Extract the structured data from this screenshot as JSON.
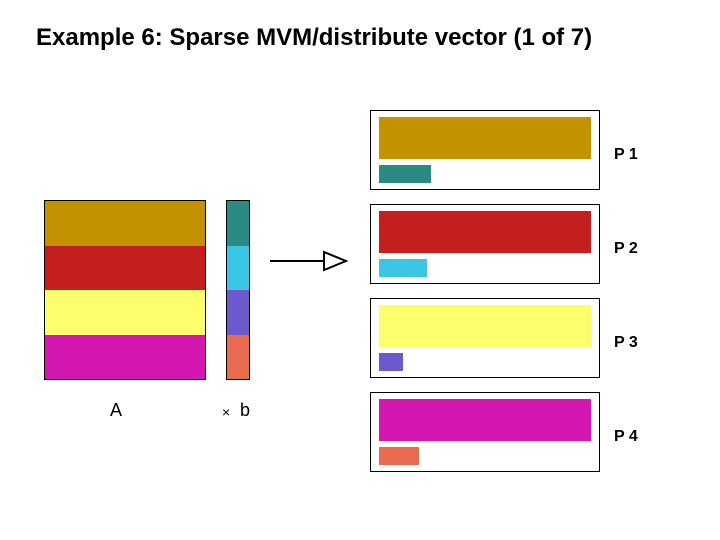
{
  "title": "Example 6: Sparse MVM/distribute vector (1 of 7)",
  "matrix_label": "A",
  "times_symbol": "×",
  "vector_label": "b",
  "matrix_rows": [
    "gold",
    "red",
    "yellow",
    "magenta"
  ],
  "vector_segments": [
    "teal",
    "cyan",
    "violet",
    "coral"
  ],
  "processors": [
    {
      "label": "P 1",
      "primary": "gold",
      "secondary": "teal",
      "secondary_width": 52
    },
    {
      "label": "P 2",
      "primary": "red",
      "secondary": "cyan",
      "secondary_width": 48
    },
    {
      "label": "P 3",
      "primary": "yellow",
      "secondary": "violet",
      "secondary_width": 24
    },
    {
      "label": "P 4",
      "primary": "magenta",
      "secondary": "coral",
      "secondary_width": 40
    }
  ],
  "colors": {
    "gold": "#c49102",
    "red": "#c41e1e",
    "yellow": "#fcff6b",
    "magenta": "#d417b1",
    "teal": "#2b8a83",
    "cyan": "#3bc6e6",
    "violet": "#6a5acd",
    "coral": "#e86a4f"
  }
}
